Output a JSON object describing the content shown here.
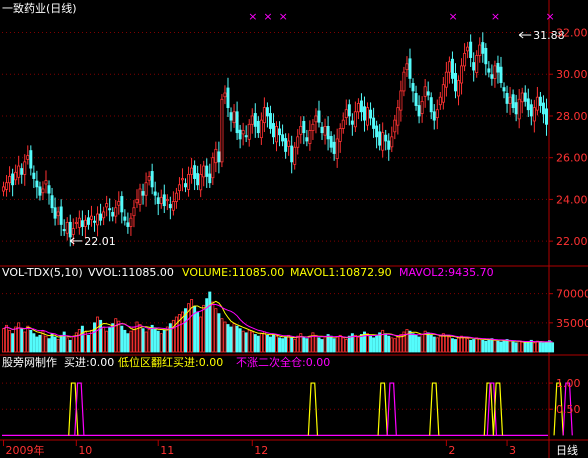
{
  "title": "一致药业(日线)",
  "colors": {
    "up": "#ff3232",
    "down": "#54fcfc",
    "grid": "#800000",
    "axis": "#b00000",
    "magenta": "#ff00ff",
    "yellow": "#ffff00",
    "white": "#ffffff"
  },
  "chart_data": [
    {
      "type": "candlestick",
      "title": "一致药业(日线)",
      "ylim": [
        21,
        32.6
      ],
      "yticks": [
        "32.00",
        "30.00",
        "28.00",
        "26.00",
        "24.00",
        "22.00"
      ],
      "ytick_values": [
        32,
        30,
        28,
        26,
        24,
        22
      ],
      "annotations": [
        {
          "label": "22.01",
          "index": 22,
          "value": 22.01
        },
        {
          "label": "31.88",
          "index": 170,
          "value": 31.88
        }
      ],
      "marker_symbol": "×",
      "top_markers": [
        82,
        87,
        92,
        148,
        162,
        180,
        197
      ],
      "closes": [
        24.6,
        24.8,
        25.1,
        24.7,
        25.3,
        25.6,
        25.2,
        25.8,
        26.1,
        25.5,
        25.0,
        24.6,
        24.2,
        24.5,
        24.9,
        24.3,
        23.6,
        23.1,
        23.4,
        22.8,
        22.5,
        22.9,
        22.2,
        22.6,
        22.9,
        23.1,
        22.7,
        23.0,
        22.8,
        23.2,
        22.9,
        23.3,
        23.0,
        23.4,
        23.8,
        23.5,
        23.2,
        23.6,
        23.9,
        23.4,
        23.0,
        22.7,
        23.1,
        23.6,
        24.0,
        24.5,
        24.2,
        24.8,
        25.1,
        24.6,
        24.2,
        23.8,
        24.1,
        23.7,
        24.0,
        23.6,
        23.9,
        24.3,
        24.7,
        25.0,
        24.6,
        25.2,
        25.5,
        25.0,
        24.7,
        25.2,
        25.6,
        25.1,
        24.8,
        26.0,
        26.4,
        25.8,
        28.8,
        29.1,
        28.4,
        27.8,
        28.2,
        27.2,
        26.9,
        27.3,
        27.0,
        27.6,
        28.0,
        27.5,
        27.2,
        27.8,
        28.4,
        28.0,
        27.4,
        27.0,
        27.5,
        27.1,
        26.8,
        26.3,
        26.8,
        25.8,
        26.5,
        27.0,
        27.5,
        27.2,
        26.8,
        27.3,
        27.6,
        28.0,
        27.7,
        27.2,
        27.5,
        26.9,
        26.5,
        26.2,
        26.9,
        27.4,
        27.8,
        28.3,
        28.0,
        27.6,
        28.2,
        28.6,
        28.2,
        27.8,
        28.4,
        27.9,
        27.4,
        27.0,
        26.6,
        27.2,
        26.8,
        26.4,
        27.0,
        27.8,
        28.4,
        29.2,
        30.1,
        30.5,
        29.8,
        29.2,
        28.5,
        28.0,
        28.7,
        29.4,
        29.0,
        28.2,
        27.8,
        28.3,
        28.9,
        29.5,
        30.1,
        30.6,
        29.8,
        29.2,
        29.7,
        30.4,
        31.0,
        31.3,
        30.8,
        30.2,
        30.9,
        31.4,
        31.0,
        30.5,
        30.1,
        29.8,
        30.4,
        30.1,
        29.6,
        29.2,
        28.6,
        28.9,
        28.4,
        28.1,
        28.8,
        29.1,
        28.7,
        28.3,
        28.0,
        28.4,
        28.9,
        28.5,
        28.1,
        27.6
      ]
    },
    {
      "type": "bar",
      "title": "VOL-TDX(5,10)",
      "labels": [
        "VOL-TDX(5,10)",
        "VVOL:11085.00",
        "VOLUME:11085.00",
        "MAVOL1:10872.90",
        "MAVOL2:9435.70"
      ],
      "ylim": [
        0,
        84000
      ],
      "yticks": [
        "70000",
        "35000"
      ],
      "ytick_values": [
        70000,
        35000
      ],
      "series": [
        {
          "name": "VOLUME",
          "value": 11085.0
        },
        {
          "name": "MAVOL1",
          "value": 10872.9
        },
        {
          "name": "MAVOL2",
          "value": 9435.7
        }
      ],
      "values": [
        28000,
        32000,
        26000,
        22000,
        30000,
        35000,
        28000,
        24000,
        31000,
        26000,
        22000,
        18000,
        20000,
        25000,
        19000,
        16000,
        22000,
        18000,
        15000,
        20000,
        24000,
        17000,
        14000,
        19000,
        23000,
        27000,
        31000,
        24000,
        20000,
        26000,
        35000,
        42000,
        38000,
        30000,
        25000,
        29000,
        34000,
        40000,
        37000,
        31000,
        26000,
        22000,
        25000,
        30000,
        36000,
        33000,
        28000,
        24000,
        27000,
        32000,
        29000,
        25000,
        22000,
        26000,
        30000,
        34000,
        38000,
        42000,
        45000,
        48000,
        52000,
        58000,
        63000,
        55000,
        48000,
        42000,
        56000,
        64000,
        72000,
        60000,
        52000,
        46000,
        40000,
        36000,
        33000,
        30000,
        34000,
        31000,
        28000,
        25000,
        23000,
        26000,
        24000,
        21000,
        19000,
        22000,
        24000,
        20000,
        18000,
        21000,
        19000,
        17000,
        16000,
        18000,
        20000,
        17000,
        15000,
        19000,
        22000,
        18000,
        16000,
        19000,
        23000,
        20000,
        17000,
        15000,
        18000,
        21000,
        19000,
        16000,
        18000,
        20000,
        17000,
        15000,
        19000,
        22000,
        20000,
        18000,
        21000,
        24000,
        22000,
        19000,
        17000,
        20000,
        23000,
        26000,
        22000,
        19000,
        17000,
        16000,
        18000,
        21000,
        24000,
        27000,
        25000,
        22000,
        20000,
        18000,
        21000,
        25000,
        23000,
        20000,
        18000,
        17000,
        19000,
        22000,
        20000,
        18000,
        16000,
        15000,
        17000,
        19000,
        18000,
        16000,
        14000,
        15000,
        17000,
        16000,
        14000,
        13000,
        15000,
        16000,
        14000,
        13000,
        12000,
        14000,
        15000,
        13000,
        12000,
        11000,
        13000,
        12000,
        11500,
        12000,
        14000,
        11000,
        13000,
        12500,
        11000,
        12000,
        13500,
        11085
      ]
    },
    {
      "type": "line",
      "title": "股旁网制作",
      "labels": [
        {
          "text": "股旁网制作",
          "color": "white"
        },
        {
          "text": "买进:0.00",
          "color": "white"
        },
        {
          "text": "低位区翻红买进:0.00",
          "color": "yellow"
        },
        {
          "text": "不涨二次全仓:0.00",
          "color": "magenta"
        }
      ],
      "ylim": [
        -0.05,
        1.25
      ],
      "yticks": [
        "1.00",
        "0.50"
      ],
      "ytick_values": [
        1.0,
        0.5
      ],
      "signals": [
        {
          "center": 23,
          "width": 3,
          "color": "yellow"
        },
        {
          "center": 25,
          "width": 3,
          "color": "magenta"
        },
        {
          "center": 102,
          "width": 3,
          "color": "yellow"
        },
        {
          "center": 125,
          "width": 3,
          "color": "yellow"
        },
        {
          "center": 128,
          "width": 3,
          "color": "magenta"
        },
        {
          "center": 142,
          "width": 3,
          "color": "yellow"
        },
        {
          "center": 160,
          "width": 3,
          "color": "yellow"
        },
        {
          "center": 161,
          "width": 3,
          "color": "magenta"
        },
        {
          "center": 163,
          "width": 3,
          "color": "yellow"
        },
        {
          "center": 183,
          "width": 3,
          "color": "yellow"
        },
        {
          "center": 186,
          "width": 3,
          "color": "magenta"
        }
      ]
    }
  ],
  "x_axis": {
    "labels": [
      {
        "text": "2009年",
        "index": 0
      },
      {
        "text": "10",
        "index": 24
      },
      {
        "text": "11",
        "index": 51
      },
      {
        "text": "12",
        "index": 82
      },
      {
        "text": "2",
        "index": 146
      },
      {
        "text": "3",
        "index": 166
      }
    ],
    "period_label": "日线"
  }
}
